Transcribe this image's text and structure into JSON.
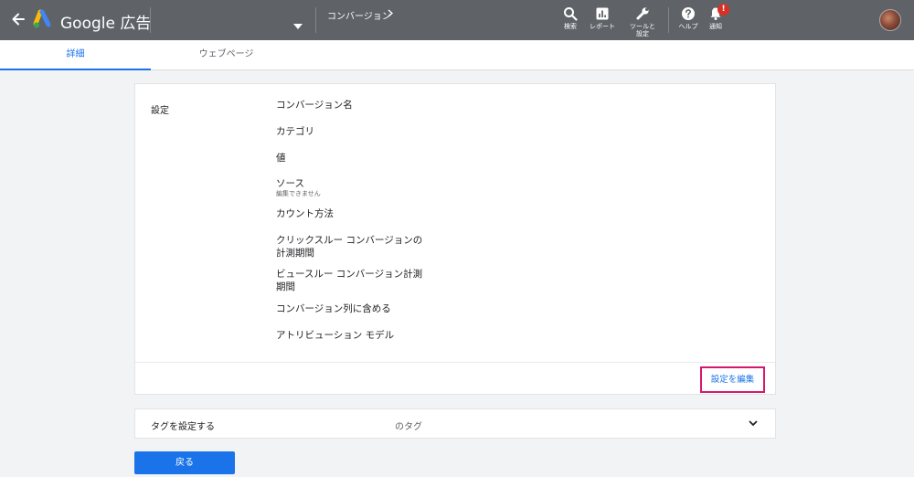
{
  "header": {
    "brand": "Google 広告",
    "breadcrumb": "コンバージョン",
    "tools": {
      "search": "検索",
      "report": "レポート",
      "tools_line1": "ツールと",
      "tools_line2": "設定",
      "help": "ヘルプ",
      "notifications": "通知",
      "notification_badge": "!"
    }
  },
  "tabs": [
    {
      "label": "詳細",
      "active": true
    },
    {
      "label": "ウェブページ",
      "active": false
    }
  ],
  "settings": {
    "section_label": "設定",
    "fields": [
      {
        "label": "コンバージョン名"
      },
      {
        "label": "カテゴリ"
      },
      {
        "label": "値"
      },
      {
        "label": "ソース",
        "note": "編集できません"
      },
      {
        "label": "カウント方法"
      },
      {
        "label": "クリックスルー コンバージョンの計測期間"
      },
      {
        "label": "ビュースルー コンバージョン計測期間"
      },
      {
        "label": "コンバージョン列に含める"
      },
      {
        "label": "アトリビューション モデル"
      }
    ],
    "edit_button": "設定を編集"
  },
  "tag_section": {
    "title": "タグを設定する",
    "subtitle": "のタグ"
  },
  "back_button": "戻る",
  "colors": {
    "topbar": "#5f6368",
    "accent": "#1a73e8",
    "highlight": "#d6176f",
    "badge": "#d93025"
  }
}
